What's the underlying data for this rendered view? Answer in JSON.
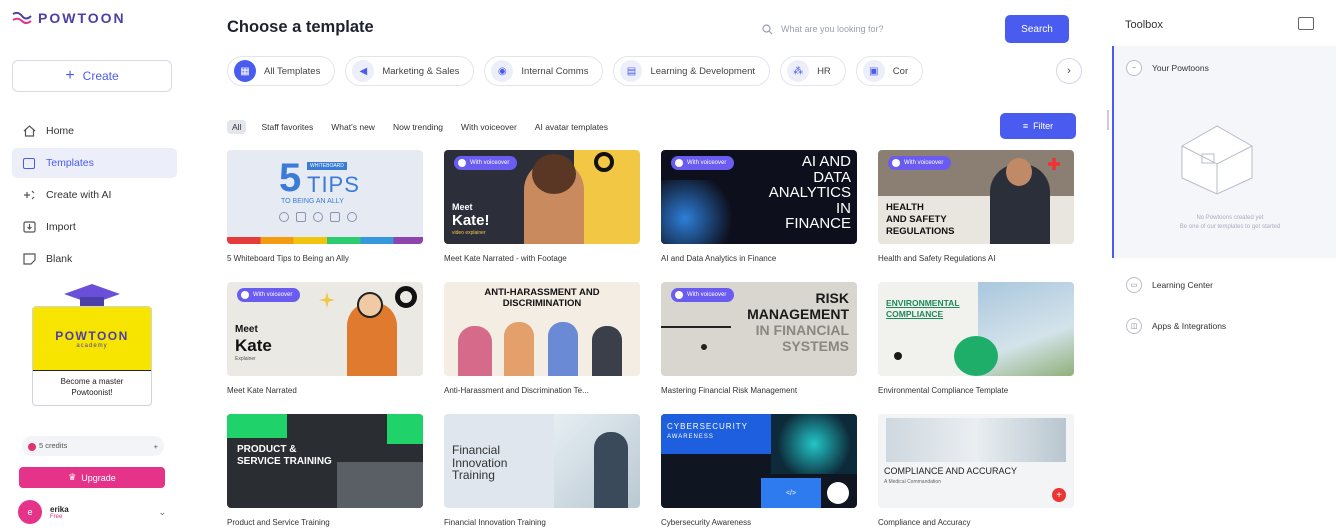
{
  "app": {
    "brand": "POWTOON"
  },
  "sidebar": {
    "create_label": "Create",
    "items": [
      {
        "label": "Home",
        "icon": "home-icon",
        "active": false
      },
      {
        "label": "Templates",
        "icon": "templates-icon",
        "active": true
      },
      {
        "label": "Create with AI",
        "icon": "ai-sparkle-icon",
        "active": false
      },
      {
        "label": "Import",
        "icon": "import-icon",
        "active": false
      },
      {
        "label": "Blank",
        "icon": "blank-icon",
        "active": false
      }
    ],
    "academy": {
      "logo": "POWTOON",
      "sub": "academy",
      "text_line1": "Become a master",
      "text_line2": "Powtoonist!"
    },
    "credits": "5 credits",
    "upgrade_label": "Upgrade",
    "user": {
      "initial": "e",
      "name": "erika",
      "plan": "Free"
    }
  },
  "header": {
    "title": "Choose a template",
    "search_placeholder": "What are you looking for?",
    "search_button": "Search"
  },
  "categories": [
    {
      "label": "All Templates",
      "icon": "grid-icon",
      "active": true
    },
    {
      "label": "Marketing & Sales",
      "icon": "megaphone-icon",
      "active": false
    },
    {
      "label": "Internal Comms",
      "icon": "chat-icon",
      "active": false
    },
    {
      "label": "Learning & Development",
      "icon": "book-icon",
      "active": false
    },
    {
      "label": "HR",
      "icon": "people-icon",
      "active": false
    },
    {
      "label": "Cor",
      "icon": "briefcase-icon",
      "active": false
    }
  ],
  "filters": {
    "chips": [
      "All",
      "Staff favorites",
      "What's new",
      "Now trending",
      "With voiceover",
      "AI avatar templates"
    ],
    "filter_button": "Filter"
  },
  "voiceover_badge": "With voiceover",
  "templates": [
    {
      "title": "5 Whiteboard Tips to Being an Ally",
      "thumb_big": "5",
      "thumb_main": "TIPS",
      "thumb_kicker": "WHITEBOARD",
      "thumb_sub": "TO BEING AN ALLY"
    },
    {
      "title": "Meet Kate Narrated - with Footage",
      "thumb_main": "Meet",
      "thumb_sub": "Kate!",
      "thumb_kicker": "video explainer"
    },
    {
      "title": "AI and Data Analytics in Finance",
      "thumb_l1": "AI AND",
      "thumb_l2": "DATA",
      "thumb_l3": "ANALYTICS",
      "thumb_l4": "IN",
      "thumb_l5": "FINANCE"
    },
    {
      "title": "Health and Safety Regulations AI",
      "thumb_l1": "HEALTH",
      "thumb_l2": "AND SAFETY",
      "thumb_l3": "REGULATIONS"
    },
    {
      "title": "Meet Kate Narrated",
      "thumb_main": "Meet",
      "thumb_sub": "Kate",
      "thumb_kicker": "Explainer"
    },
    {
      "title": "Anti-Harassment and Discrimination Te...",
      "thumb_l1": "ANTI-HARASSMENT AND",
      "thumb_l2": "DISCRIMINATION"
    },
    {
      "title": "Mastering Financial Risk Management",
      "thumb_l1": "RISK",
      "thumb_l2": "MANAGEMENT",
      "thumb_l3": "IN FINANCIAL",
      "thumb_l4": "SYSTEMS"
    },
    {
      "title": "Environmental Compliance Template",
      "thumb_l1": "ENVIRONMENTAL",
      "thumb_l2": "COMPLIANCE"
    },
    {
      "title": "Product and Service Training",
      "thumb_l1": "PRODUCT &",
      "thumb_l2": "SERVICE TRAINING"
    },
    {
      "title": "Financial Innovation Training",
      "thumb_l1": "Financial",
      "thumb_l2": "Innovation",
      "thumb_l3": "Training"
    },
    {
      "title": "Cybersecurity Awareness",
      "thumb_l1": "CYBERSECURITY",
      "thumb_l2": "AWARENESS"
    },
    {
      "title": "Compliance and Accuracy",
      "thumb_l1": "COMPLIANCE AND ACCURACY",
      "thumb_l2": "A Medical Commandation"
    }
  ],
  "toolbox": {
    "title": "Toolbox",
    "sections": [
      "Your Powtoons",
      "Learning Center",
      "Apps & Integrations"
    ],
    "empty_line1": "No Powtoons created yet",
    "empty_line2": "Be one of our templates to get started"
  },
  "colors": {
    "accent": "#4a5cf0",
    "upgrade": "#e6338a",
    "academy_yellow": "#f7e500"
  }
}
